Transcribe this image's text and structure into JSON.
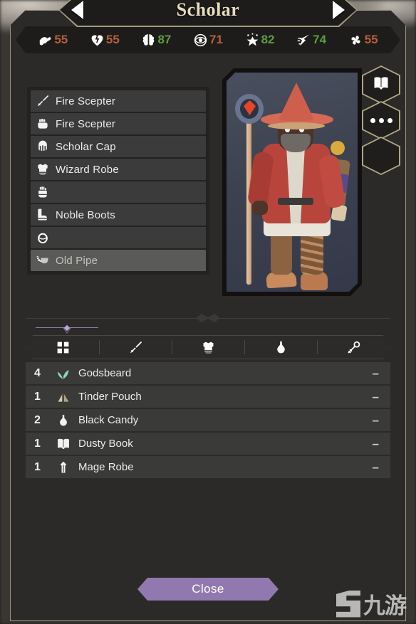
{
  "header": {
    "title": "Scholar",
    "prev_label": "prev-character",
    "next_label": "next-character"
  },
  "stats": [
    {
      "icon": "strength-icon",
      "value": "55",
      "color": "#b5603c"
    },
    {
      "icon": "vitality-icon",
      "value": "55",
      "color": "#b5603c"
    },
    {
      "icon": "intellect-icon",
      "value": "87",
      "color": "#5d9e3f"
    },
    {
      "icon": "perception-icon",
      "value": "71",
      "color": "#b5603c"
    },
    {
      "icon": "magic-icon",
      "value": "82",
      "color": "#5d9e3f"
    },
    {
      "icon": "agility-icon",
      "value": "74",
      "color": "#5d9e3f"
    },
    {
      "icon": "luck-icon",
      "value": "55",
      "color": "#b5603c"
    }
  ],
  "equipment": [
    {
      "icon": "sword-icon",
      "label": "Fire Scepter",
      "selected": false
    },
    {
      "icon": "fist-icon",
      "label": "Fire Scepter",
      "selected": false
    },
    {
      "icon": "helmet-icon",
      "label": "Scholar Cap",
      "selected": false
    },
    {
      "icon": "armor-icon",
      "label": "Wizard Robe",
      "selected": false
    },
    {
      "icon": "glove-icon",
      "label": "",
      "selected": false
    },
    {
      "icon": "boot-icon",
      "label": "Noble Boots",
      "selected": false
    },
    {
      "icon": "ring-icon",
      "label": "",
      "selected": false
    },
    {
      "icon": "pipe-icon",
      "label": "Old Pipe",
      "selected": true
    }
  ],
  "side_buttons": [
    {
      "icon": "book-icon",
      "label": "journal"
    },
    {
      "icon": "dots-icon",
      "label": "more-options"
    },
    {
      "icon": "empty-icon",
      "label": "empty-slot"
    }
  ],
  "tabs": [
    {
      "icon": "all-items-icon",
      "label": "all",
      "active": true
    },
    {
      "icon": "sword-icon",
      "label": "weapons",
      "active": false
    },
    {
      "icon": "armor-icon",
      "label": "armor",
      "active": false
    },
    {
      "icon": "potion-icon",
      "label": "potions",
      "active": false
    },
    {
      "icon": "misc-icon",
      "label": "misc",
      "active": false
    }
  ],
  "inventory": [
    {
      "qty": "4",
      "icon": "herb-icon",
      "name": "Godsbeard",
      "action": "–",
      "color": "#8fd6b4"
    },
    {
      "qty": "1",
      "icon": "pouch-icon",
      "name": "Tinder Pouch",
      "action": "–",
      "color": "#d9c6a4"
    },
    {
      "qty": "2",
      "icon": "flask-icon",
      "name": "Black Candy",
      "action": "–",
      "color": "#f2f2f2"
    },
    {
      "qty": "1",
      "icon": "book-icon",
      "name": "Dusty Book",
      "action": "–",
      "color": "#f2f2f2"
    },
    {
      "qty": "1",
      "icon": "robe-icon",
      "name": "Mage Robe",
      "action": "–",
      "color": "#f2f2f2"
    }
  ],
  "footer": {
    "close_label": "Close"
  },
  "watermark": {
    "text": "九游"
  },
  "theme": {
    "panel_bg": "#2b2a28",
    "border_gold": "#9a9378",
    "accent_purple": "#9179b0",
    "stat_green": "#5d9e3f",
    "stat_orange": "#b5603c"
  }
}
